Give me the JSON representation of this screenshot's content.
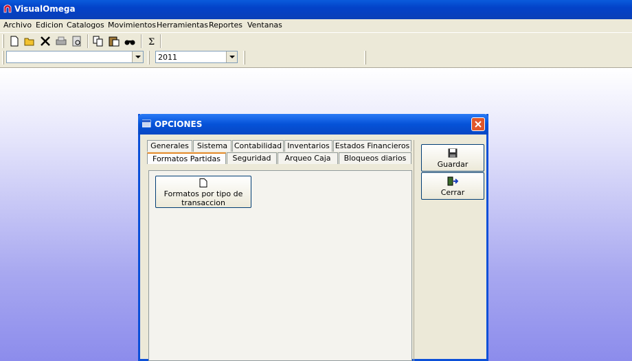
{
  "app": {
    "title": "VisualOmega"
  },
  "menu": [
    "Archivo",
    "Edicion",
    "Catalogos",
    "Movimientos",
    "Herramientas",
    "Reportes",
    "Ventanas"
  ],
  "toolbar": {
    "icons": [
      "new-icon",
      "open-icon",
      "delete-icon",
      "print-icon",
      "preview-icon",
      "copy-icon",
      "paste-icon",
      "find-icon",
      "sum-icon"
    ]
  },
  "combos": {
    "company": "",
    "year": "2011"
  },
  "dialog": {
    "title": "OPCIONES",
    "tabs_row1": [
      "Generales",
      "Sistema",
      "Contabilidad",
      "Inventarios",
      "Estados Financieros"
    ],
    "tabs_row2": [
      "Formatos Partidas",
      "Seguridad",
      "Arqueo Caja",
      "Bloqueos diarios"
    ],
    "active_tab": "Formatos Partidas",
    "panel_button": {
      "line1": "Formatos por tipo de",
      "line2": "transaccion"
    },
    "save_label": "Guardar",
    "close_label": "Cerrar"
  }
}
